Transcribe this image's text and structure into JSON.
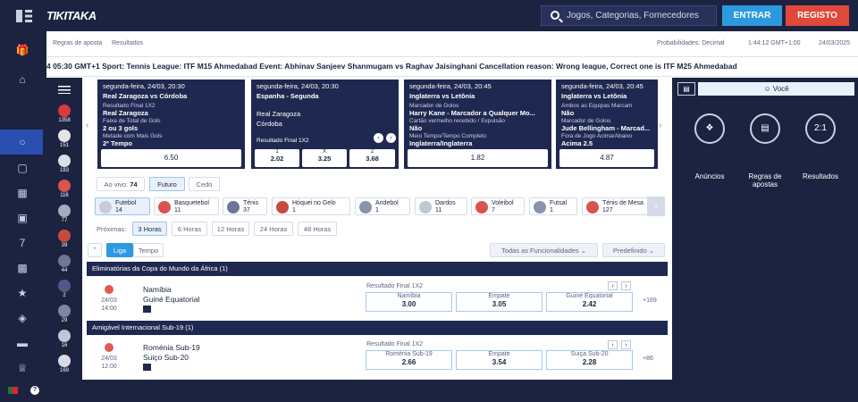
{
  "header": {
    "logo": "TIKITAKA",
    "search_placeholder": "Jogos, Categorias, Fornecedores",
    "login_label": "ENTRAR",
    "register_label": "REGISTO"
  },
  "subnav": {
    "links": [
      "Regras de aposta",
      "Resultados"
    ],
    "odds_label": "Probabilidades: Decimal",
    "time_label": "1:44:12 GMT+1:00",
    "date_label": "24/03/2025"
  },
  "ticker": "4 05:30 GMT+1 Sport: Tennis League: ITF M15 Ahmedabad Event: Abhinav Sanjeev Shanmugam vs Raghav Jaisinghani Cancellation reason: Wrong league, Correct one is ITF M25 Ahmedabad",
  "sport_column": [
    {
      "count": "1358"
    },
    {
      "count": "151"
    },
    {
      "count": "183"
    },
    {
      "count": "116"
    },
    {
      "count": "77"
    },
    {
      "count": "39"
    },
    {
      "count": "44"
    },
    {
      "count": "2"
    },
    {
      "count": "29"
    },
    {
      "count": "16"
    },
    {
      "count": "169"
    }
  ],
  "cards": [
    {
      "header": "segunda-feira, 24/03, 20:30",
      "match": "Real Zaragoza vs Córdoba",
      "lines": [
        {
          "label": "Resultado Final 1X2",
          "value": "Real Zaragoza"
        },
        {
          "label": "Faixa de Total de Gols",
          "value": "2 ou 3 gols"
        },
        {
          "label": "Metade com Mais Gols",
          "value": "2º Tempo"
        }
      ],
      "odd": "6.50"
    },
    {
      "header": "segunda-feira, 24/03, 20:30",
      "match": "Espanha - Segunda",
      "teams": [
        "Real Zaragoza",
        "Córdoba"
      ],
      "market": "Resultado Final 1X2",
      "outcomes": [
        {
          "label": "1",
          "odd": "2.02"
        },
        {
          "label": "X",
          "odd": "3.25"
        },
        {
          "label": "2",
          "odd": "3.68"
        }
      ]
    },
    {
      "header": "segunda-feira, 24/03, 20:45",
      "match": "Inglaterra vs Letônia",
      "lines": [
        {
          "label": "Marcador de Golos",
          "value": "Harry Kane - Marcador a Qualquer Mo..."
        },
        {
          "label": "Cartão vermelho recebido / Expulsão",
          "value": "Não"
        },
        {
          "label": "Meio Tempo/Tempo Completo",
          "value": "Inglaterra/Inglaterra"
        }
      ],
      "odd": "1.82"
    },
    {
      "header": "segunda-feira, 24/03, 20:45",
      "match": "Inglaterra vs Letônia",
      "lines": [
        {
          "label": "Ambos as Equipas Marcam",
          "value": "Não"
        },
        {
          "label": "Marcador de Golos",
          "value": "Jude Bellingham - Marcad..."
        },
        {
          "label": "Fora de Jogo Acima/Abaixo",
          "value": "Acima 2.5"
        }
      ],
      "odd": "4.87"
    }
  ],
  "tabs": [
    {
      "label": "Ao vivo:",
      "count": "74"
    },
    {
      "label": "Futuro"
    },
    {
      "label": "Cedo"
    }
  ],
  "sports": [
    {
      "name": "Futebol",
      "count": "14"
    },
    {
      "name": "Basquetebol",
      "count": "11"
    },
    {
      "name": "Ténis",
      "count": "37"
    },
    {
      "name": "Hóquei no Gelo",
      "count": "1"
    },
    {
      "name": "Andebol",
      "count": "1"
    },
    {
      "name": "Dardos",
      "count": "11"
    },
    {
      "name": "Voleibol",
      "count": "7"
    },
    {
      "name": "Futsal",
      "count": "1"
    },
    {
      "name": "Ténis de Mesa",
      "count": "127"
    }
  ],
  "proximas": {
    "label": "Próximas:",
    "options": [
      "3 Horas",
      "6 Horas",
      "12 Horas",
      "24 Horas",
      "48 Horas"
    ]
  },
  "view_tabs": [
    "Liga",
    "Tempo"
  ],
  "dropdowns": [
    "Todas as Funcionalidades",
    "Predefinido"
  ],
  "events": [
    {
      "section": "Eliminatórias da Copa do Mundo da África (1)",
      "date": "24/03",
      "time": "14:00",
      "home": "Namíbia",
      "away": "Guiné Equatorial",
      "market": "Resultado Final 1X2",
      "outcomes": [
        {
          "label": "Namíbia",
          "odd": "3.00"
        },
        {
          "label": "Empate",
          "odd": "3.05"
        },
        {
          "label": "Guiné Equatorial",
          "odd": "2.42"
        }
      ],
      "more": "+169"
    },
    {
      "section": "Amigável Internacional Sub-19 (1)",
      "date": "24/03",
      "time": "12:00",
      "home": "Roménia Sub-19",
      "away": "Suiço Sub-20",
      "market": "Resultado Final 1X2",
      "outcomes": [
        {
          "label": "Roménia Sub-19",
          "odd": "2.66"
        },
        {
          "label": "Empate",
          "odd": "3.54"
        },
        {
          "label": "Suiça Sub-20",
          "odd": "2.28"
        }
      ],
      "more": "+86"
    }
  ],
  "rightpanel": {
    "user_label": "Você",
    "buttons": [
      {
        "label": "Anúncios"
      },
      {
        "label": "Regras de apostas"
      },
      {
        "label": "Resultados",
        "icon_text": "2:1"
      }
    ]
  }
}
